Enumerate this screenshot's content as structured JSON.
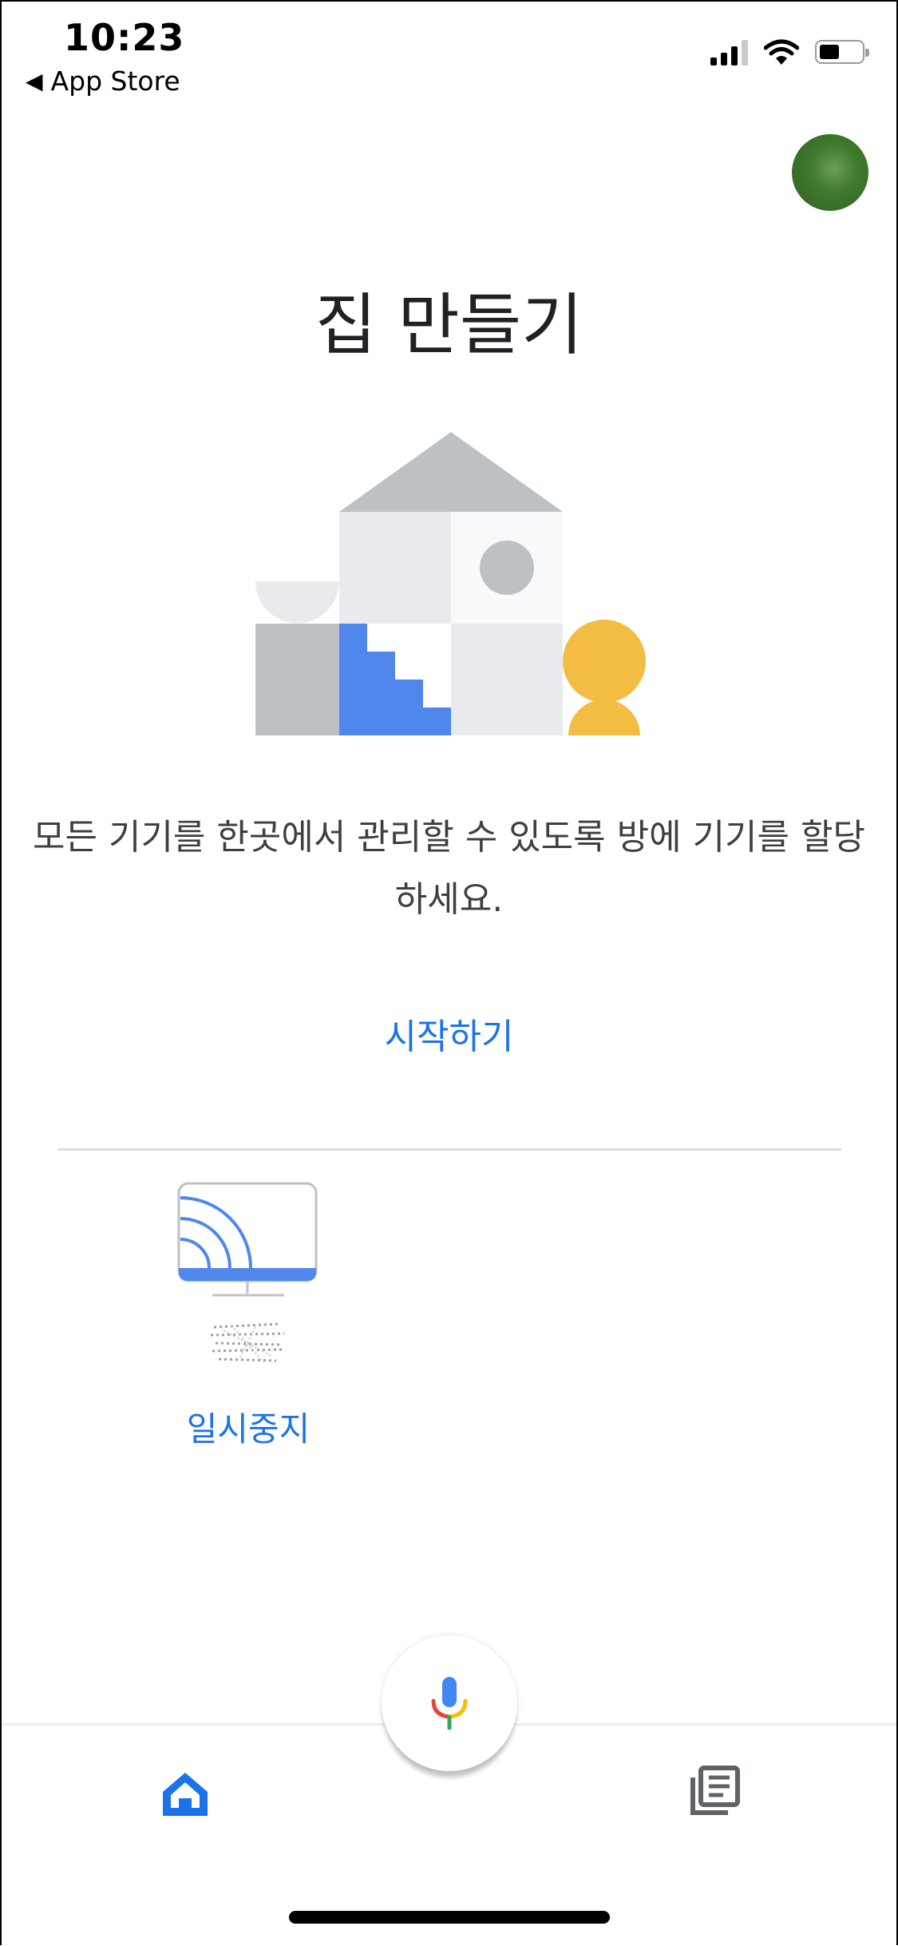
{
  "status_bar": {
    "time": "10:23",
    "back_label": "App Store",
    "back_glyph": "◀",
    "icons": [
      "cellular-signal-icon",
      "wifi-icon",
      "battery-icon"
    ]
  },
  "header": {
    "avatar_icon": "account-avatar"
  },
  "main": {
    "title": "집 만들기",
    "description": "모든 기기를 한곳에서 관리할 수 있도록 방에 기기를 할당하세요.",
    "start_link": "시작하기"
  },
  "device": {
    "icon": "cast-display-icon",
    "action_label": "일시중지"
  },
  "bottom_nav": {
    "items": [
      {
        "icon": "home-icon",
        "active": true
      },
      {
        "icon": "mic-icon",
        "active": false
      },
      {
        "icon": "feed-icon",
        "active": false
      }
    ]
  },
  "colors": {
    "accent": "#1a73e8",
    "illustration_gray": "#bdc1c6",
    "illustration_light": "#e8eaed",
    "illustration_blue": "#5087ec",
    "illustration_yellow": "#f2bd42",
    "mic_blue": "#4285f4",
    "mic_red": "#ea4335",
    "mic_yellow": "#fbbc05",
    "mic_green": "#34a853"
  }
}
